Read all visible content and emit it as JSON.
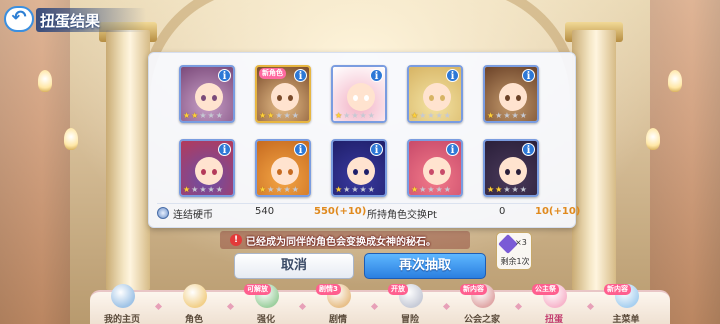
{
  "header": {
    "back_icon": "back-arrow-icon",
    "title": "扭蛋结果"
  },
  "results": [
    {
      "stars": 2,
      "max_stars": 5,
      "rarity": "silver",
      "colors": [
        "#c8a0c8",
        "#7b4a7a"
      ]
    },
    {
      "stars": 2,
      "max_stars": 5,
      "rarity": "gold",
      "badge": "新角色",
      "colors": [
        "#e8c08a",
        "#7a4a2a"
      ]
    },
    {
      "stars": 1,
      "max_stars": 5,
      "rarity": "silver",
      "colors": [
        "#f3b3c6",
        "#ffffff"
      ]
    },
    {
      "stars": 1,
      "max_stars": 5,
      "rarity": "silver",
      "colors": [
        "#f3e3a4",
        "#d7b464"
      ]
    },
    {
      "stars": 1,
      "max_stars": 5,
      "rarity": "silver",
      "colors": [
        "#c49a6c",
        "#6b4228"
      ]
    },
    {
      "stars": 1,
      "max_stars": 5,
      "rarity": "silver",
      "colors": [
        "#6a4fa8",
        "#b43a5a"
      ]
    },
    {
      "stars": 1,
      "max_stars": 5,
      "rarity": "silver",
      "colors": [
        "#f4a645",
        "#c66a20"
      ]
    },
    {
      "stars": 1,
      "max_stars": 5,
      "rarity": "silver",
      "colors": [
        "#3a3aa0",
        "#1f1f6a"
      ]
    },
    {
      "stars": 1,
      "max_stars": 5,
      "rarity": "silver",
      "colors": [
        "#f27a8a",
        "#c84a6a"
      ]
    },
    {
      "stars": 2,
      "max_stars": 5,
      "rarity": "silver",
      "colors": [
        "#4a3a5a",
        "#2a1f3a"
      ]
    }
  ],
  "info_label": "i",
  "stats": {
    "coin_label": "连结硬币",
    "coin_value": "540",
    "coin_gain": "550(+10)",
    "pt_label": "所持角色交换Pt",
    "pt_value": "0",
    "pt_gain": "10(+10)"
  },
  "message": "已经成为同伴的角色会变换成女神的秘石。",
  "message_icon": "!",
  "buttons": {
    "cancel": "取消",
    "again": "再次抽取"
  },
  "remaining": {
    "multiplier": "×3",
    "label": "剩余1次"
  },
  "nav": [
    {
      "label": "我的主页",
      "icon": "castle-icon",
      "color": "#9fc3e6"
    },
    {
      "label": "角色",
      "icon": "character-icon",
      "color": "#f2d08a"
    },
    {
      "label": "强化",
      "icon": "enhance-icon",
      "color": "#9ed0a0",
      "badge": "可解放"
    },
    {
      "label": "剧情",
      "icon": "story-icon",
      "color": "#e8c08a",
      "badge": "剧情3"
    },
    {
      "label": "冒险",
      "icon": "sword-icon",
      "color": "#c8ccd8",
      "badge": "开放"
    },
    {
      "label": "公会之家",
      "icon": "guild-house-icon",
      "color": "#e0a8a8",
      "badge": "新内容"
    },
    {
      "label": "扭蛋",
      "icon": "gacha-icon",
      "color": "#f7b6cc",
      "badge": "公主祭",
      "active": true
    },
    {
      "label": "主菜单",
      "icon": "menu-icon",
      "color": "#a8d0f0",
      "badge": "新内容"
    }
  ]
}
